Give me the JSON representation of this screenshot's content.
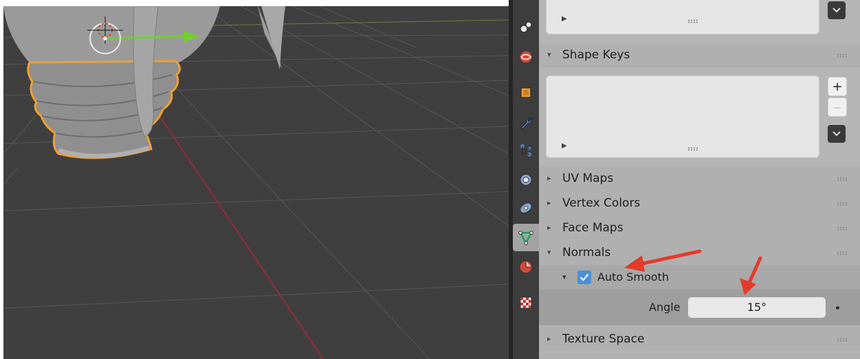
{
  "properties": {
    "sections": {
      "shape_keys": {
        "label": "Shape Keys",
        "add_symbol": "+",
        "remove_symbol": "—"
      },
      "uv_maps": {
        "label": "UV Maps"
      },
      "vertex_colors": {
        "label": "Vertex Colors"
      },
      "face_maps": {
        "label": "Face Maps"
      },
      "normals": {
        "label": "Normals"
      },
      "texture_space": {
        "label": "Texture Space"
      }
    },
    "auto_smooth": {
      "label": "Auto Smooth",
      "checked": true
    },
    "angle": {
      "label": "Angle",
      "value": "15°"
    },
    "collapsed_symbol": "▸",
    "expanded_symbol": "▾"
  },
  "tabs": [
    {
      "name": "physics-particles-tab-icon"
    },
    {
      "name": "scene-world-tab-icon"
    },
    {
      "name": "object-tab-icon"
    },
    {
      "name": "modifier-wrench-tab-icon"
    },
    {
      "name": "particles-tab-icon"
    },
    {
      "name": "physics-tab-icon"
    },
    {
      "name": "constraints-tab-icon"
    },
    {
      "name": "mesh-data-tab-icon",
      "active": true
    },
    {
      "name": "material-tab-icon"
    },
    {
      "name": "texture-tab-icon"
    }
  ],
  "colors": {
    "viewport_bg": "#3f3f3f",
    "selection_outline": "#f0a030",
    "x_axis": "#9a2a3a",
    "gizmo_arrow": "#6fd12a",
    "annotation_arrow": "#e23b2a",
    "checkbox": "#4a90d9"
  }
}
